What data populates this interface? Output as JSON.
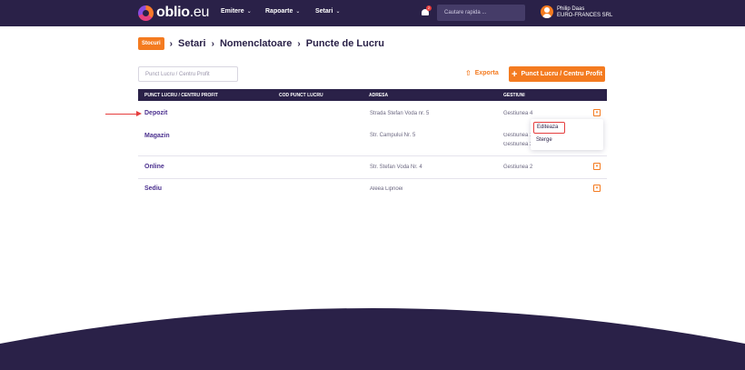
{
  "header": {
    "logo_text": "oblio",
    "logo_tld": ".eu",
    "nav": [
      {
        "label": "Emitere"
      },
      {
        "label": "Rapoarte"
      },
      {
        "label": "Setari"
      }
    ],
    "notification_count": "2",
    "search_placeholder": "Cautare rapida ...",
    "user_name": "Philip Daas",
    "user_company": "EURO-FRANCES SRL"
  },
  "breadcrumb": {
    "badge": "Stocuri",
    "items": [
      "Setari",
      "Nomenclatoare",
      "Puncte de Lucru"
    ]
  },
  "toolbar": {
    "search_placeholder": "Punct Lucru / Centru Profit",
    "export_label": "Exporta",
    "add_label": "Punct Lucru / Centru Profit"
  },
  "table": {
    "columns": [
      "PUNCT LUCRU / CENTRU PROFIT",
      "COD PUNCT LUCRU",
      "ADRESA",
      "GESTIUNI"
    ],
    "rows": [
      {
        "name": "Depozit",
        "code": "",
        "address": "Strada Stefan Voda nr. 5",
        "gestiuni": "Gestiunea 4"
      },
      {
        "name": "Magazin",
        "code": "",
        "address": "Str. Campului Nr. 5",
        "gestiuni": "Gestiunea 1",
        "gestiuni_2": "Gestiunea 3"
      },
      {
        "name": "Online",
        "code": "",
        "address": "Str. Stefan Voda Nr. 4",
        "gestiuni": "Gestiunea 2"
      },
      {
        "name": "Sediu",
        "code": "",
        "address": "Aleea Lipnoei",
        "gestiuni": ""
      }
    ]
  },
  "dropdown": {
    "edit_label": "Editeaza",
    "delete_label": "Sterge"
  },
  "colors": {
    "brand_dark": "#2a2148",
    "accent": "#f47b20",
    "highlight": "#e53e3e"
  }
}
